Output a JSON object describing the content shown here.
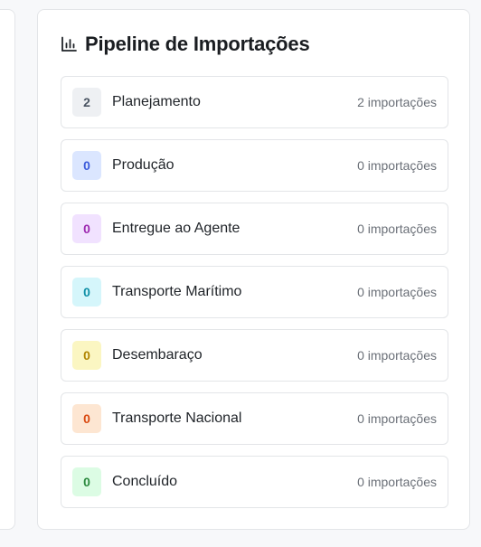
{
  "pipeline": {
    "title": "Pipeline de Importações",
    "icon": "bar-chart-icon",
    "stages": [
      {
        "name": "Planejamento",
        "count": "2",
        "count_text": "2 importações",
        "badge_bg": "#eef0f3",
        "badge_fg": "#4b5563"
      },
      {
        "name": "Produção",
        "count": "0",
        "count_text": "0 importações",
        "badge_bg": "#dbe6ff",
        "badge_fg": "#3b5bdb"
      },
      {
        "name": "Entregue ao Agente",
        "count": "0",
        "count_text": "0 importações",
        "badge_bg": "#f1e2ff",
        "badge_fg": "#9c27b0"
      },
      {
        "name": "Transporte Marítimo",
        "count": "0",
        "count_text": "0 importações",
        "badge_bg": "#d5f6fb",
        "badge_fg": "#0e8fa6"
      },
      {
        "name": "Desembaraço",
        "count": "0",
        "count_text": "0 importações",
        "badge_bg": "#fbf6c2",
        "badge_fg": "#b08400"
      },
      {
        "name": "Transporte Nacional",
        "count": "0",
        "count_text": "0 importações",
        "badge_bg": "#fde6d2",
        "badge_fg": "#d9480f"
      },
      {
        "name": "Concluído",
        "count": "0",
        "count_text": "0 importações",
        "badge_bg": "#dcfce4",
        "badge_fg": "#2b8a3e"
      }
    ]
  }
}
